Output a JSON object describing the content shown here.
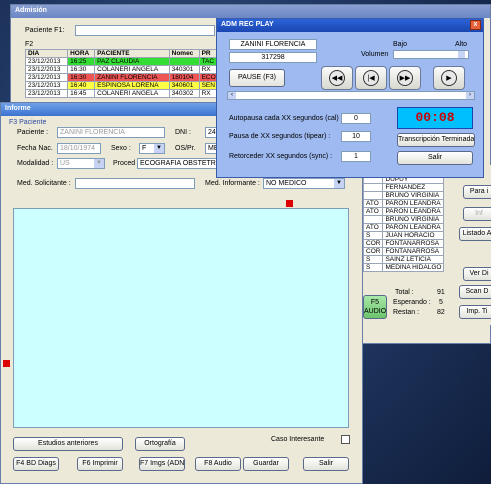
{
  "admision": {
    "title": "Admisión",
    "paciente_label": "Paciente  F1:",
    "f2_label": "F2",
    "columns": [
      "DIA",
      "HORA",
      "PACIENTE",
      "Nomec",
      "PR"
    ],
    "rows": [
      {
        "dia": "23/12/2013",
        "hora": "16:25",
        "paciente": "PAZ  CLAUDIA",
        "nomec": "",
        "pr": "TAC",
        "color": "#33dd33"
      },
      {
        "dia": "23/12/2013",
        "hora": "16:30",
        "paciente": "COLANERI  ANGELA",
        "nomec": "340301",
        "pr": "RX",
        "color": "#ffffff"
      },
      {
        "dia": "23/12/2013",
        "hora": "16:30",
        "paciente": "ZANINI  FLORENCIA",
        "nomec": "180104",
        "pr": "ECO",
        "color": "#ee5555"
      },
      {
        "dia": "23/12/2013",
        "hora": "16:40",
        "paciente": "ESPINOSA  LORENA",
        "nomec": "340601",
        "pr": "SEN",
        "color": "#ffff44"
      },
      {
        "dia": "23/12/2013",
        "hora": "16:45",
        "paciente": "COLANERI  ANGELA",
        "nomec": "340302",
        "pr": "RX",
        "color": "#ffffff"
      }
    ],
    "right_list": [
      {
        "a": "",
        "b": "DUPUY"
      },
      {
        "a": "",
        "b": "FERNANDEZ"
      },
      {
        "a": "",
        "b": "BRUNO VIRGINIA"
      },
      {
        "a": "ATO",
        "b": "PARON LEANDRA"
      },
      {
        "a": "ATO",
        "b": "PARON LEANDRA"
      },
      {
        "a": "",
        "b": "BRUNO VIRGINIA"
      },
      {
        "a": "ATO",
        "b": "PARON LEANDRA"
      },
      {
        "a": "S",
        "b": "JUAN HORACIO"
      },
      {
        "a": "COR",
        "b": "FONTANARROSA"
      },
      {
        "a": "COR",
        "b": "FONTANARROSA"
      },
      {
        "a": "S",
        "b": "SAINZ LETICIA"
      },
      {
        "a": "S",
        "b": "MEDINA HIDALGO"
      }
    ],
    "f5_label": "F5\nAUDIO",
    "total_label": "Total  :",
    "total_value": "91",
    "esperando_label": "Esperando :",
    "esperando_value": "5",
    "restan_label": "Restan  :",
    "restan_value": "82",
    "side_buttons": [
      "Para i",
      "Inf ",
      "Listado A",
      "Ver Di",
      "Scan D",
      "Imp. Ti"
    ]
  },
  "player": {
    "title": "ADM REC PLAY",
    "patient_name": "ZANINI FLORENCIA",
    "patient_id": "317298",
    "pause_label": "PAUSE (F3)",
    "bajo": "Bajo",
    "alto": "Alto",
    "volumen": "Volumen",
    "autopausa_label": "Autopausa cada XX segundos (cal) :",
    "autopausa_value": "0",
    "pausa_label": "Pausa de XX segundos (tipear) :",
    "pausa_value": "10",
    "retroceder_label": "Retorceder XX segundos (sync) :",
    "retroceder_value": "1",
    "timer": "00:08",
    "transcripcion_label": "Transcripción Terminada",
    "salir_label": "Salir",
    "close": "x"
  },
  "informe": {
    "title": "Informe",
    "f3_label": "F3 Paciente",
    "paciente_label": "Paciente :",
    "paciente_value": "ZANINI  FLORENCIA",
    "dni_label": "DNI :",
    "dni_value": "24",
    "fecha_label": "Fecha Nac.",
    "fecha_value": "18/10/1974",
    "sexo_label": "Sexo :",
    "sexo_value": "F",
    "ospr_label": "OS/Pr.",
    "ospr_value": "ME",
    "modalidad_label": "Modalidad :",
    "modalidad_value": "US",
    "proced_label": "Proced",
    "proced_value": "ECOGRAFIA OBSTETRIC",
    "med_solic_label": "Med. Solicitante :",
    "med_inf_label": "Med. Informante :",
    "med_inf_value": "NO MEDICO",
    "caso_label": "Caso Interesante",
    "buttons_row1": [
      "Estudios anteriores",
      "Ortografía"
    ],
    "buttons_row2": [
      "F4 BD Diags",
      "F6 Imprimir",
      "F7 Imgs (ADNI)",
      "F8 Audio",
      "Guardar",
      "Salir"
    ]
  },
  "colors": {
    "accent": "#5c78b8",
    "text_area": "#ccffff",
    "timer_bg": "#00bfff",
    "timer_text": "#cc0000"
  }
}
